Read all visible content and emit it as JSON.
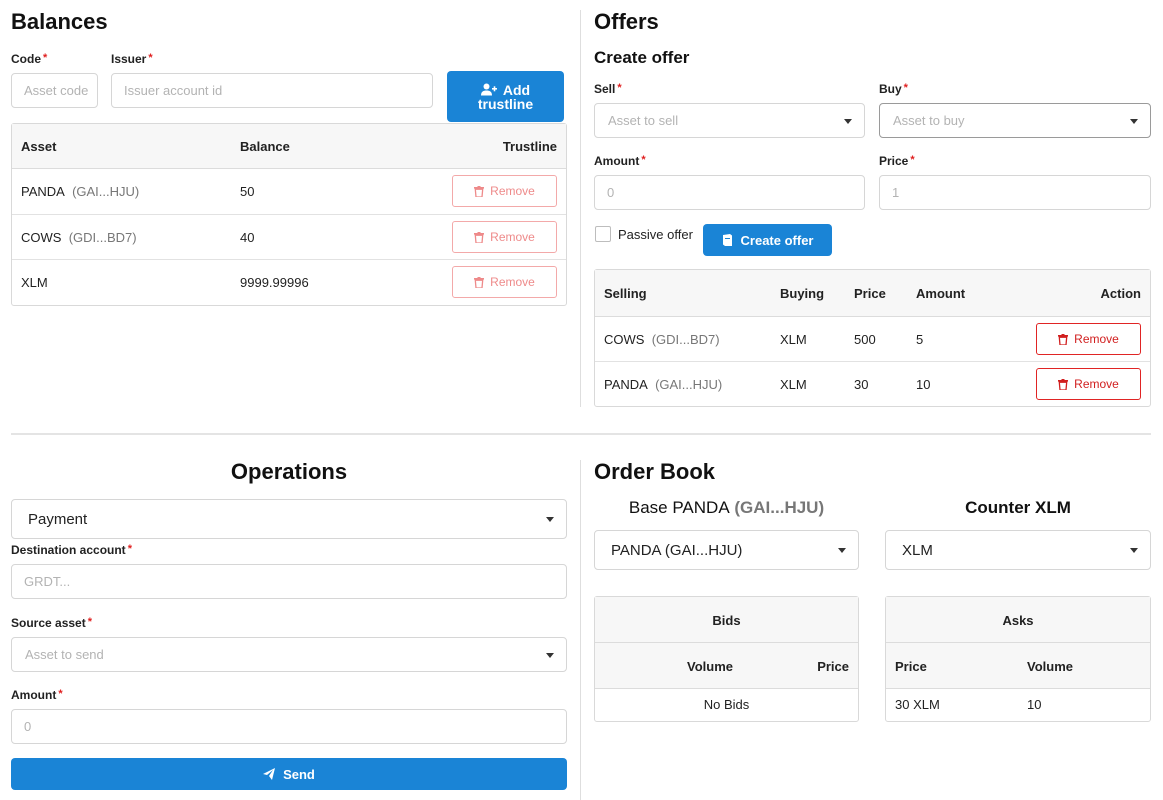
{
  "balances": {
    "title": "Balances",
    "code_label": "Code",
    "code_placeholder": "Asset code",
    "issuer_label": "Issuer",
    "issuer_placeholder": "Issuer account id",
    "add_button_line1": "Add",
    "add_button_line2": "trustline",
    "columns": [
      "Asset",
      "Balance",
      "Trustline"
    ],
    "rows": [
      {
        "asset": "PANDA",
        "issuer": "(GAI...HJU)",
        "balance": "50",
        "action": "Remove"
      },
      {
        "asset": "COWS",
        "issuer": "(GDI...BD7)",
        "balance": "40",
        "action": "Remove"
      },
      {
        "asset": "XLM",
        "issuer": "",
        "balance": "9999.99996",
        "action": "Remove"
      }
    ]
  },
  "offers": {
    "title": "Offers",
    "subtitle": "Create offer",
    "sell_label": "Sell",
    "sell_placeholder": "Asset to sell",
    "buy_label": "Buy",
    "buy_placeholder": "Asset to buy",
    "amount_label": "Amount",
    "amount_placeholder": "0",
    "price_label": "Price",
    "price_placeholder": "1",
    "passive_label": "Passive offer",
    "create_button": "Create offer",
    "columns": [
      "Selling",
      "Buying",
      "Price",
      "Amount",
      "Action"
    ],
    "rows": [
      {
        "selling": "COWS",
        "issuer": "(GDI...BD7)",
        "buying": "XLM",
        "price": "500",
        "amount": "5",
        "action": "Remove"
      },
      {
        "selling": "PANDA",
        "issuer": "(GAI...HJU)",
        "buying": "XLM",
        "price": "30",
        "amount": "10",
        "action": "Remove"
      }
    ]
  },
  "operations": {
    "title": "Operations",
    "type_value": "Payment",
    "destination_label": "Destination account",
    "destination_placeholder": "GRDT...",
    "source_label": "Source asset",
    "source_placeholder": "Asset to send",
    "amount_label": "Amount",
    "amount_placeholder": "0",
    "send_button": "Send"
  },
  "orderbook": {
    "title": "Order Book",
    "base_label": "Base PANDA",
    "base_issuer": "(GAI...HJU)",
    "counter_label": "Counter XLM",
    "base_select": "PANDA (GAI...HJU)",
    "counter_select": "XLM",
    "bids": {
      "title": "Bids",
      "col_volume": "Volume",
      "col_price": "Price",
      "empty": "No Bids"
    },
    "asks": {
      "title": "Asks",
      "col_price": "Price",
      "col_volume": "Volume",
      "rows": [
        {
          "price": "30 XLM",
          "volume": "10"
        }
      ]
    }
  },
  "colors": {
    "primary": "#1a84d6",
    "danger": "#e02424",
    "required": "#e02020"
  }
}
